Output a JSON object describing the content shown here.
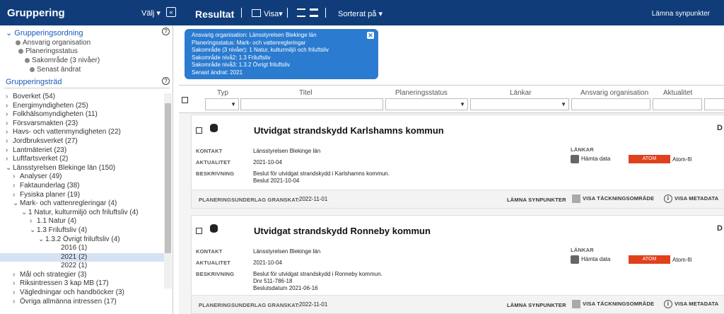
{
  "topbar": {
    "left_title": "Gruppering",
    "valj": "Välj",
    "collapse_icon": "«",
    "result_title": "Resultat",
    "visa": "Visa",
    "sort": "Sorterat på",
    "feedback": "Lämna synpunkter"
  },
  "grouping": {
    "order_heading": "Grupperingsordning",
    "order": [
      "Ansvarig organisation",
      "Planeringsstatus",
      "Sakområde (3 nivåer)",
      "Senast ändrat"
    ],
    "tree_heading": "Grupperingsträd",
    "help_icon": "?"
  },
  "tree": [
    {
      "label": "Boverket (54)",
      "chevron": "›",
      "level": 0
    },
    {
      "label": "Energimyndigheten (25)",
      "chevron": "›",
      "level": 0
    },
    {
      "label": "Folkhälsomyndigheten (11)",
      "chevron": "›",
      "level": 0
    },
    {
      "label": "Försvarsmakten (23)",
      "chevron": "›",
      "level": 0
    },
    {
      "label": "Havs- och vattenmyndigheten (22)",
      "chevron": "›",
      "level": 0
    },
    {
      "label": "Jordbruksverket (27)",
      "chevron": "›",
      "level": 0
    },
    {
      "label": "Lantmäteriet (23)",
      "chevron": "›",
      "level": 0
    },
    {
      "label": "Luftfartsverket (2)",
      "chevron": "›",
      "level": 0
    },
    {
      "label": "Länsstyrelsen Blekinge län (150)",
      "chevron": "⌄",
      "level": 0
    },
    {
      "label": "Analyser (49)",
      "chevron": "›",
      "level": 1
    },
    {
      "label": "Faktaunderlag (38)",
      "chevron": "›",
      "level": 1
    },
    {
      "label": "Fysiska planer (19)",
      "chevron": "›",
      "level": 1
    },
    {
      "label": "Mark- och vattenregleringar (4)",
      "chevron": "⌄",
      "level": 1
    },
    {
      "label": "1 Natur, kulturmiljö och friluftsliv (4)",
      "chevron": "⌄",
      "level": 2
    },
    {
      "label": "1.1 Natur (4)",
      "chevron": "›",
      "level": 3
    },
    {
      "label": "1.3 Friluftsliv (4)",
      "chevron": "⌄",
      "level": 3
    },
    {
      "label": "1.3.2 Övrigt friluftsliv (4)",
      "chevron": "⌄",
      "level": 4
    },
    {
      "label": "2016 (1)",
      "chevron": "",
      "level": 5
    },
    {
      "label": "2021 (2)",
      "chevron": "",
      "level": 5,
      "selected": true
    },
    {
      "label": "2022 (1)",
      "chevron": "",
      "level": 5
    },
    {
      "label": "Mål och strategier (3)",
      "chevron": "›",
      "level": 1
    },
    {
      "label": "Riksintressen 3 kap MB (17)",
      "chevron": "›",
      "level": 1
    },
    {
      "label": "Vägledningar och handböcker (3)",
      "chevron": "›",
      "level": 1
    },
    {
      "label": "Övriga allmänna intressen (17)",
      "chevron": "›",
      "level": 1
    }
  ],
  "filter_popup": {
    "lines": [
      "Ansvarig organisation: Länsstyrelsen Blekinge län",
      "Planeringsstatus: Mark- och vattenregleringar",
      "Sakområde (3 nivåer): 1 Natur, kulturmiljö och friluftsliv",
      "Sakområde nivå2: 1.3 Friluftsliv",
      "Sakområde nivå3: 1.3.2 Övrigt friluftsliv",
      "Senast ändrat: 2021"
    ],
    "close_icon": "✕"
  },
  "columns": [
    "Typ",
    "Titel",
    "Planeringsstatus",
    "Länkar",
    "Ansvarig organisation",
    "Aktualitet"
  ],
  "cards": [
    {
      "title": "Utvidgat strandskydd Karlshamns kommun",
      "kontakt_label": "KONTAKT",
      "kontakt": "Länsstyrelsen Blekinge län",
      "aktualitet_label": "AKTUALITET",
      "aktualitet": "2021-10-04",
      "beskrivning_label": "BESKRIVNING",
      "beskrivning": [
        "Beslut för utvidgat strandskydd i Karlshamns kommun.",
        "Beslut 2021-10-04"
      ],
      "lankar_label": "LÄNKAR",
      "hamta": "Hämta data",
      "atom": "ATOM",
      "atom_fil": "Atom-fil",
      "granskat_label": "PLANERINGSUNDERLAG GRANSKAT:",
      "granskat": "2022-11-01",
      "lamna": "LÄMNA SYNPUNKTER",
      "tackning": "VISA TÄCKNINGSOMRÅDE",
      "metadata": "VISA METADATA",
      "corner": "D"
    },
    {
      "title": "Utvidgat strandskydd Ronneby kommun",
      "kontakt_label": "KONTAKT",
      "kontakt": "Länsstyrelsen Blekinge län",
      "aktualitet_label": "AKTUALITET",
      "aktualitet": "2021-10-04",
      "beskrivning_label": "BESKRIVNING",
      "beskrivning": [
        "Beslut för utvidgat strandskydd i Ronneby kommun.",
        "Dnr 511-786-18",
        "Beslutsdatum 2021-06-16"
      ],
      "lankar_label": "LÄNKAR",
      "hamta": "Hämta data",
      "atom": "ATOM",
      "atom_fil": "Atom-fil",
      "granskat_label": "PLANERINGSUNDERLAG GRANSKAT:",
      "granskat": "2022-11-01",
      "lamna": "LÄMNA SYNPUNKTER",
      "tackning": "VISA TÄCKNINGSOMRÅDE",
      "metadata": "VISA METADATA",
      "corner": "D"
    }
  ]
}
